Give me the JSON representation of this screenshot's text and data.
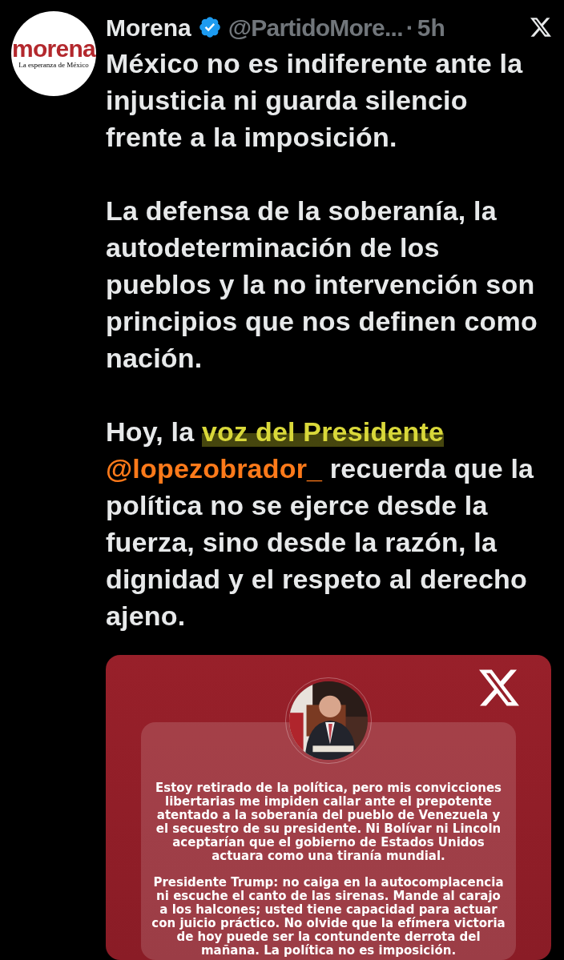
{
  "post": {
    "avatar": {
      "logo_name": "morena",
      "logo_tagline": "La esperanza de México"
    },
    "author": "Morena",
    "verified": true,
    "handle": "@PartidoMore...",
    "separator": "·",
    "time": "5h",
    "paragraphs": [
      [
        {
          "kind": "text",
          "text": "México no es indiferente ante la injusticia ni guarda silencio frente a la imposición."
        }
      ],
      [
        {
          "kind": "text",
          "text": "La defensa de la soberanía, la autodeterminación de los pueblos y la no intervención son principios que nos definen como nación."
        }
      ],
      [
        {
          "kind": "text",
          "text": "Hoy, la "
        },
        {
          "kind": "highlight",
          "text": "voz del Presidente"
        },
        {
          "kind": "space"
        },
        {
          "kind": "mention",
          "text": "@lopezobrador_"
        },
        {
          "kind": "text",
          "text": " recuerda que la política no se ejerce desde la fuerza, sino desde la razón, la dignidad y el respeto al derecho ajeno."
        }
      ]
    ],
    "media": {
      "portrait": {
        "kind": "picture"
      },
      "paragraphs": [
        "Estoy retirado de la política, pero mis convicciones libertarias me impiden callar ante el prepotente atentado a la soberanía del pueblo de Venezuela y el secuestro de su presidente. Ni Bolívar ni Lincoln aceptarían que el gobierno de Estados Unidos actuara como una tiranía mundial.",
        "Presidente Trump: no caiga en la autocomplacencia ni escuche el canto de las sirenas. Mande al carajo a los halcones; usted tiene capacidad para actuar con juicio práctico. No olvide que la efímera victoria de hoy puede ser la contundente derrota del mañana. La política no es imposición."
      ]
    }
  }
}
